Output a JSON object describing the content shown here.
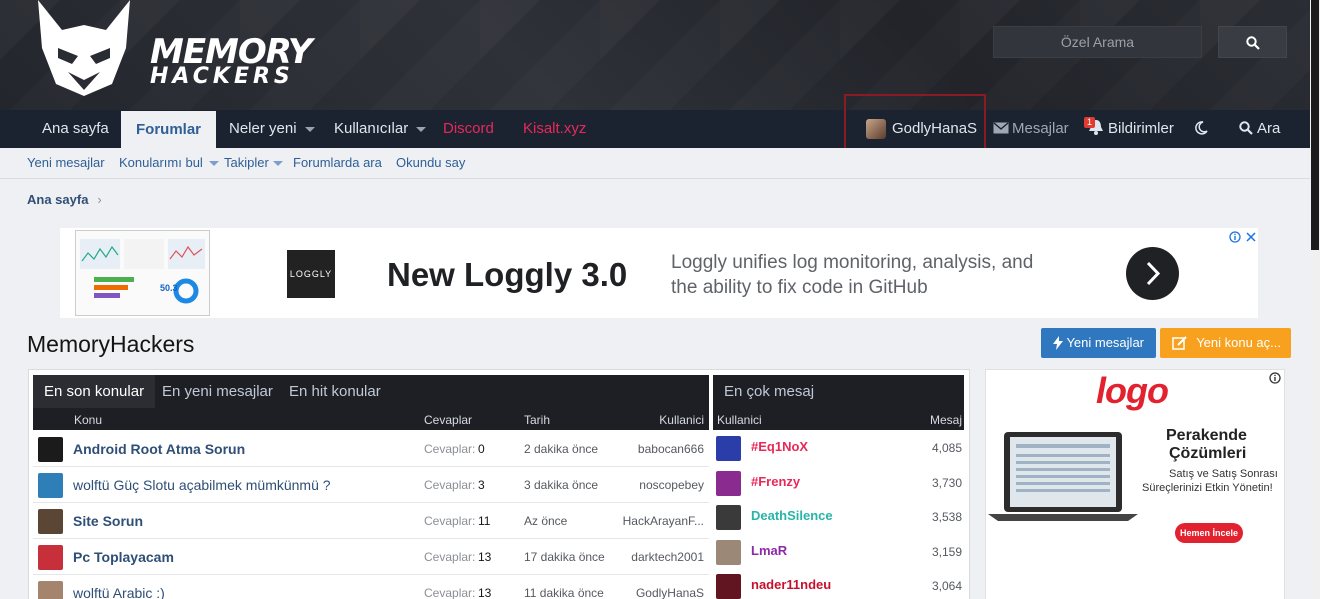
{
  "header": {
    "logo_word_1": "MEMORY",
    "logo_word_2": "HACKERS",
    "search_placeholder": "Özel Arama",
    "search_icon": "search-icon"
  },
  "nav": {
    "items": [
      {
        "label": "Ana sayfa"
      },
      {
        "label": "Forumlar"
      },
      {
        "label": "Neler yeni"
      },
      {
        "label": "Kullanıcılar"
      },
      {
        "label": "Discord"
      },
      {
        "label": "Kisalt.xyz"
      }
    ],
    "username": "GodlyHanaS",
    "messages": "Mesajlar",
    "notifications": "Bildirimler",
    "notification_count": "1",
    "search": "Ara"
  },
  "subnav": {
    "items": [
      "Yeni mesajlar",
      "Konularımı bul",
      "Takipler",
      "Forumlarda ara",
      "Okundu say"
    ]
  },
  "breadcrumb": "Ana sayfa",
  "ad": {
    "logo_text": "LOGGLY",
    "headline": "New Loggly 3.0",
    "description": "Loggly unifies log monitoring, analysis, and the ability to fix code in GitHub",
    "thumb_value": "50.3"
  },
  "page_title": "MemoryHackers",
  "buttons": {
    "new_messages": "Yeni mesajlar",
    "new_topic": "Yeni konu aç..."
  },
  "topics": {
    "tabs": [
      "En son konular",
      "En yeni mesajlar",
      "En hit konular"
    ],
    "headers": {
      "topic": "Konu",
      "replies": "Cevaplar",
      "date": "Tarih",
      "user": "Kullanici"
    },
    "rows": [
      {
        "title": "Android Root Atma Sorun",
        "bold": true,
        "replies_label": "Cevaplar:",
        "replies": "0",
        "date": "2 dakika önce",
        "user": "babocan666",
        "color": "#1b1b1b"
      },
      {
        "title": "wolftü Güç Slotu açabilmek mümkünmü ?",
        "bold": false,
        "replies_label": "Cevaplar:",
        "replies": "3",
        "date": "3 dakika önce",
        "user": "noscopebey",
        "color": "#2e7fb8"
      },
      {
        "title": "Site Sorun",
        "bold": true,
        "replies_label": "Cevaplar:",
        "replies": "11",
        "date": "Az önce",
        "user": "HackArayanF...",
        "color": "#5b4636"
      },
      {
        "title": "Pc Toplayacam",
        "bold": true,
        "replies_label": "Cevaplar:",
        "replies": "13",
        "date": "17 dakika önce",
        "user": "darktech2001",
        "color": "#c72f3a"
      },
      {
        "title": "wolftü Arabic :)",
        "bold": false,
        "replies_label": "Cevaplar:",
        "replies": "13",
        "date": "11 dakika önce",
        "user": "GodlyHanaS",
        "color": "#a5846d"
      }
    ]
  },
  "top_posters": {
    "title": "En çok mesaj",
    "headers": {
      "user": "Kullanici",
      "count": "Mesaj"
    },
    "rows": [
      {
        "name": "#Eq1NoX",
        "count": "4,085",
        "color": "#e7295a",
        "av": "#2a3da8"
      },
      {
        "name": "#Frenzy",
        "count": "3,730",
        "color": "#e7295a",
        "av": "#8a2b8f"
      },
      {
        "name": "DeathSilence",
        "count": "3,538",
        "color": "#27b5a8",
        "av": "#3a3a3a"
      },
      {
        "name": "LmaR",
        "count": "3,159",
        "color": "#8e2aa8",
        "av": "#9c8877"
      },
      {
        "name": "nader11ndeu",
        "count": "3,064",
        "color": "#c8102e",
        "av": "#601520"
      }
    ]
  },
  "side_ad": {
    "brand": "logo",
    "title_1": "Perakende",
    "title_2": "Çözümleri",
    "subtitle_1": "Satış ve Satış Sonrası",
    "subtitle_2": "Süreçlerinizi Etkin Yönetin!",
    "cta": "Hemen İncele"
  }
}
